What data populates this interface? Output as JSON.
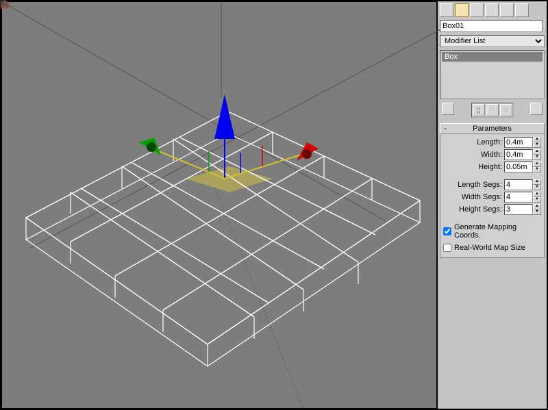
{
  "object_name": "Box01",
  "modifier_list_label": "Modifier List",
  "stack": {
    "item": "Box"
  },
  "rollout": {
    "title": "Parameters",
    "toggle": "-",
    "length_label": "Length:",
    "width_label": "Width:",
    "height_label": "Height:",
    "length_segs_label": "Length Segs:",
    "width_segs_label": "Width Segs:",
    "height_segs_label": "Height Segs:",
    "length": "0.4m",
    "width": "0.4m",
    "height": "0.05m",
    "length_segs": "4",
    "width_segs": "4",
    "height_segs": "3",
    "gen_mapping_label": "Generate Mapping Coords.",
    "real_world_label": "Real-World Map Size"
  },
  "spin_up": "▲",
  "spin_down": "▼"
}
